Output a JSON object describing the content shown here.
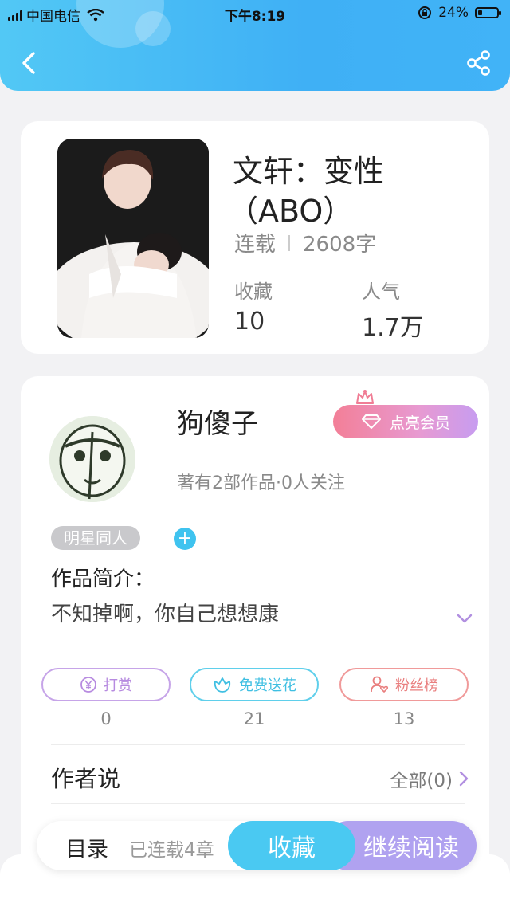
{
  "status_bar": {
    "carrier": "中国电信",
    "time": "下午8:19",
    "battery": "24%",
    "battery_level": 0.24
  },
  "header": {
    "back_icon": "chevron-left-icon",
    "share_icon": "share-icon"
  },
  "book": {
    "title_line1": "文轩：变性",
    "title_line2": "（ABO）",
    "status": "连载",
    "word_count": "2608字",
    "favorites_label": "收藏",
    "favorites_value": "10",
    "popularity_label": "人气",
    "popularity_value": "1.7万"
  },
  "author": {
    "name": "狗傻子",
    "stats": "著有2部作品·0人关注",
    "vip_label": "点亮会员"
  },
  "tags": [
    {
      "label": "明星同人"
    }
  ],
  "intro": {
    "label": "作品简介：",
    "text": "不知掉啊，你自己想想康"
  },
  "actions": [
    {
      "label": "打赏",
      "count": "0",
      "color": "#b78be0"
    },
    {
      "label": "免费送花",
      "count": "21",
      "color": "#4cc7e8"
    },
    {
      "label": "粉丝榜",
      "count": "13",
      "color": "#ef8a8a"
    }
  ],
  "author_says": {
    "label": "作者说",
    "all_label": "全部(0)"
  },
  "bottom_bar": {
    "toc_label": "目录",
    "chapters_text": "已连载4章",
    "collect_label": "收藏",
    "read_label": "继续阅读"
  },
  "colors": {
    "header_gradient_start": "#52c8f5",
    "header_gradient_end": "#41b3f7",
    "accent_blue": "#4ac9f2",
    "accent_purple": "#b0a2f0"
  }
}
